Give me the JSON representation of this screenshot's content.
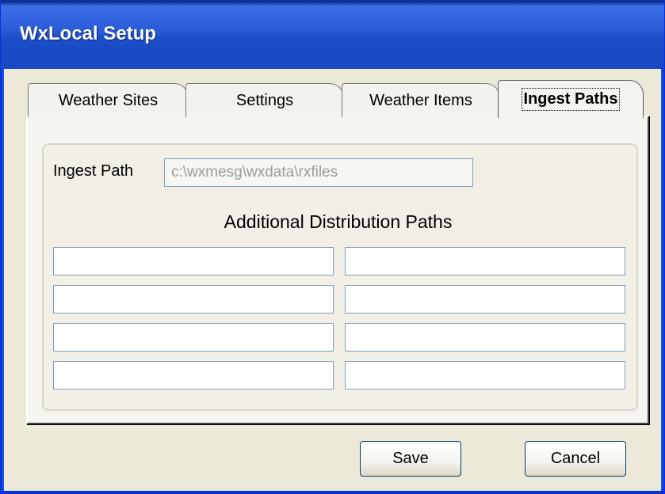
{
  "window": {
    "title": "WxLocal Setup"
  },
  "tabs": [
    {
      "label": "Weather Sites",
      "active": false
    },
    {
      "label": "Settings",
      "active": false
    },
    {
      "label": "Weather Items",
      "active": false
    },
    {
      "label": "Ingest Paths",
      "active": true
    }
  ],
  "ingest": {
    "label": "Ingest Path",
    "value": "c:\\wxmesg\\wxdata\\rxfiles"
  },
  "distribution": {
    "heading": "Additional Distribution Paths",
    "paths": [
      "",
      "",
      "",
      "",
      "",
      "",
      "",
      ""
    ]
  },
  "buttons": {
    "save": "Save",
    "cancel": "Cancel"
  },
  "colors": {
    "titlebar": "#2a5bd7",
    "background": "#ece9d8",
    "input_border": "#7f9db9"
  }
}
